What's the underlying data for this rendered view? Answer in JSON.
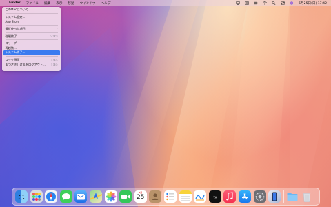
{
  "menubar": {
    "items": [
      "Finder",
      "ファイル",
      "編集",
      "表示",
      "移動",
      "ウインドウ",
      "ヘルプ"
    ],
    "clock": "5月25日(日)  17:42",
    "right_icons": [
      "screen-mirroring-icon",
      "control-center-icon",
      "display-icon",
      "battery-icon",
      "wifi-icon",
      "search-icon",
      "siri-icon"
    ]
  },
  "apple_menu": {
    "items": [
      {
        "label": "このMacについて",
        "shortcut": ""
      },
      {
        "sep": true
      },
      {
        "label": "システム設定...",
        "shortcut": ""
      },
      {
        "label": "App Store",
        "shortcut": ""
      },
      {
        "sep": true
      },
      {
        "label": "最近使った項目",
        "shortcut": "",
        "submenu": true
      },
      {
        "sep": true
      },
      {
        "label": "強制終了...",
        "shortcut": "⌥⌘⎋"
      },
      {
        "sep": true
      },
      {
        "label": "スリープ",
        "shortcut": ""
      },
      {
        "label": "再起動...",
        "shortcut": ""
      },
      {
        "label": "システム終了...",
        "shortcut": "",
        "selected": true
      },
      {
        "sep": true
      },
      {
        "label": "ロック画面",
        "shortcut": "^⌘Q"
      },
      {
        "label": "まつざきしげるをログアウト...",
        "shortcut": "⇧⌘Q"
      }
    ]
  },
  "dock": {
    "calendar_month": "5月",
    "calendar_day": "25",
    "apps": [
      "finder",
      "launchpad",
      "safari",
      "messages",
      "mail",
      "maps",
      "photos",
      "facetime",
      "calendar",
      "contacts",
      "reminders",
      "notes",
      "freeform",
      "tv",
      "music",
      "app-store",
      "system-settings",
      "iphone-mirroring",
      "downloads",
      "trash"
    ],
    "colors": {
      "finder": "#3b8fe8",
      "launchpad": "#8a8f99",
      "safari": "#2a7ef0",
      "messages": "#3ecf5a",
      "mail": "#3a8ef2",
      "maps": "#52b96a",
      "facetime": "#34c759",
      "contacts": "#b9936a",
      "freeform": "#ffffff",
      "tv": "#111111",
      "music": "#fa3c55",
      "app-store": "#1f8ff2",
      "system-settings": "#8e8e93",
      "downloads": "#5aa9ee"
    }
  }
}
